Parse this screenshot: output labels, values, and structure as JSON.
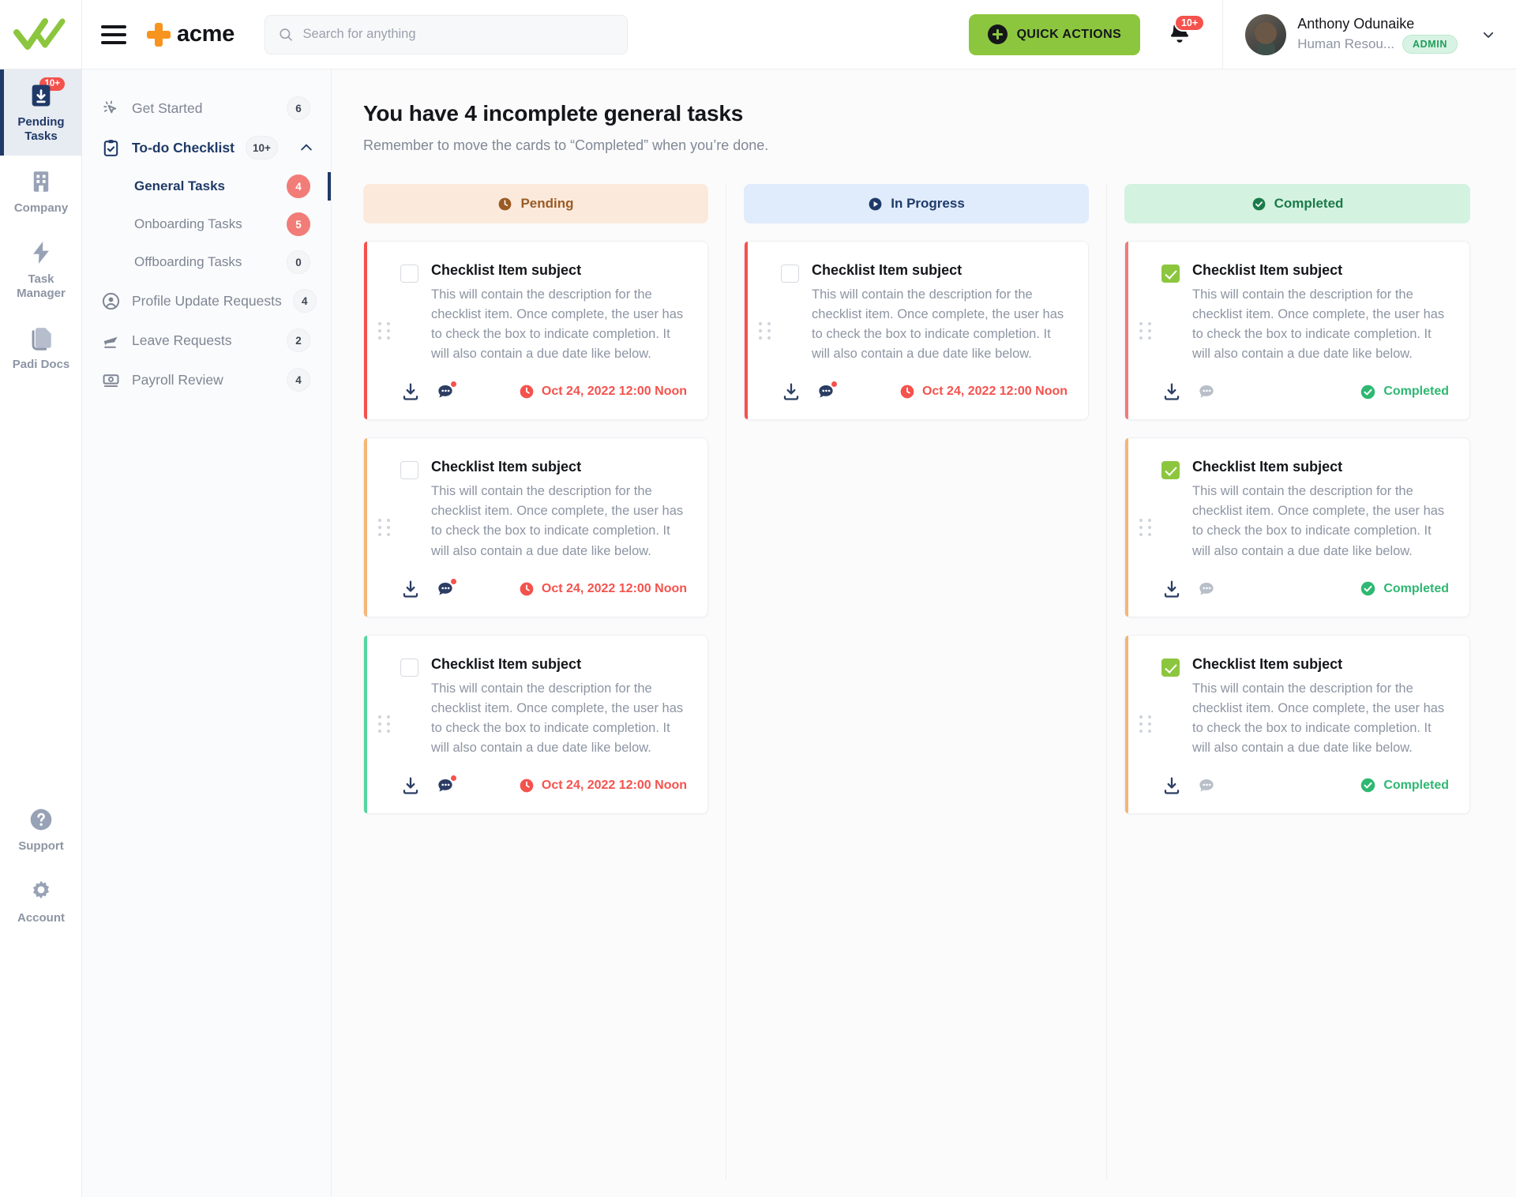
{
  "topbar": {
    "logo_icon": "double-check-logo",
    "menu_icon": "hamburger-menu-icon",
    "brand_icon": "orange-cross-icon",
    "brand_name": "acme",
    "search": {
      "icon": "search-icon",
      "value": "",
      "placeholder": "Search for anything"
    },
    "quick_actions": {
      "icon": "plus-circle-icon",
      "label": "QUICK ACTIONS",
      "color": "#8CC63E"
    },
    "notifications": {
      "icon": "bell-icon",
      "badge": "10+",
      "badge_color": "#F4524D"
    },
    "user": {
      "avatar": "user-avatar",
      "name": "Anthony Odunaike",
      "role": "Human Resou...",
      "tag": "ADMIN",
      "tag_color": "#1f9d5b",
      "chevron": "chevron-down-icon"
    }
  },
  "rail": {
    "items": [
      {
        "icon": "inbox-download-icon",
        "label": "Pending\nTasks",
        "label_line1": "Pending",
        "label_line2": "Tasks",
        "badge": "10+",
        "active": true
      },
      {
        "icon": "building-icon",
        "label": "Company",
        "badge": "",
        "active": false
      },
      {
        "icon": "bolt-icon",
        "label_line1": "Task",
        "label_line2": "Manager",
        "badge": "",
        "active": false
      },
      {
        "icon": "documents-icon",
        "label": "Padi Docs",
        "badge": "",
        "active": false
      }
    ],
    "bottom": [
      {
        "icon": "question-circle-icon",
        "label": "Support"
      },
      {
        "icon": "gear-icon",
        "label": "Account"
      }
    ]
  },
  "subnav": {
    "items": [
      {
        "icon": "cursor-click-icon",
        "label": "Get Started",
        "badge": "6",
        "badge_style": "plain",
        "current": false
      },
      {
        "icon": "clipboard-check-icon",
        "label": "To-do Checklist",
        "badge": "10+",
        "badge_style": "plain",
        "current": true,
        "caret": "chevron-up-icon"
      },
      {
        "icon": "",
        "label": "General Tasks",
        "badge": "4",
        "badge_style": "red",
        "sub": true,
        "selected": true
      },
      {
        "icon": "",
        "label": "Onboarding Tasks",
        "badge": "5",
        "badge_style": "red",
        "sub": true,
        "selected": false
      },
      {
        "icon": "",
        "label": "Offboarding Tasks",
        "badge": "0",
        "badge_style": "plain",
        "sub": true,
        "selected": false
      },
      {
        "icon": "user-circle-icon",
        "label": "Profile Update Requests",
        "badge": "4",
        "badge_style": "plain",
        "current": false
      },
      {
        "icon": "airplane-icon",
        "label": "Leave Requests",
        "badge": "2",
        "badge_style": "plain",
        "current": false
      },
      {
        "icon": "money-icon",
        "label": "Payroll Review",
        "badge": "4",
        "badge_style": "plain",
        "current": false
      }
    ]
  },
  "main": {
    "title": "You have 4 incomplete general tasks",
    "subtitle": "Remember to move the cards to “Completed” when you’re done.",
    "columns": [
      {
        "id": "pending",
        "label": "Pending",
        "icon": "clock-icon",
        "cards": [
          {
            "accent": "#F4524D",
            "checked": false,
            "title": "Checklist Item subject",
            "desc": "This will contain the description for the checklist item. Once complete, the user has to check the box to indicate completion. It will also contain a due date like below.",
            "download_icon": "download-icon",
            "comment_icon": "comment-icon",
            "comment_unread": true,
            "status_icon": "clock-icon",
            "status_text": "Oct 24, 2022 12:00 Noon",
            "status_kind": "due"
          },
          {
            "accent": "#F5B678",
            "checked": false,
            "title": "Checklist Item subject",
            "desc": "This will contain the description for the checklist item. Once complete, the user has to check the box to indicate completion. It will also contain a due date like below.",
            "download_icon": "download-icon",
            "comment_icon": "comment-icon",
            "comment_unread": true,
            "status_icon": "clock-icon",
            "status_text": "Oct 24, 2022 12:00 Noon",
            "status_kind": "due"
          },
          {
            "accent": "#54D6A0",
            "checked": false,
            "title": "Checklist Item subject",
            "desc": "This will contain the description for the checklist item. Once complete, the user has to check the box to indicate completion. It will also contain a due date like below.",
            "download_icon": "download-icon",
            "comment_icon": "comment-icon",
            "comment_unread": true,
            "status_icon": "clock-icon",
            "status_text": "Oct 24, 2022 12:00 Noon",
            "status_kind": "due"
          }
        ]
      },
      {
        "id": "in-progress",
        "label": "In Progress",
        "icon": "play-circle-icon",
        "cards": [
          {
            "accent": "#F4524D",
            "checked": false,
            "title": "Checklist Item subject",
            "desc": "This will contain the description for the checklist item. Once complete, the user has to check the box to indicate completion. It will also contain a due date like below.",
            "download_icon": "download-icon",
            "comment_icon": "comment-icon",
            "comment_unread": true,
            "status_icon": "clock-icon",
            "status_text": "Oct 24, 2022 12:00 Noon",
            "status_kind": "due"
          }
        ]
      },
      {
        "id": "completed",
        "label": "Completed",
        "icon": "check-circle-icon",
        "cards": [
          {
            "accent": "#F27C78",
            "checked": true,
            "title": "Checklist Item subject",
            "desc": "This will contain the description for the checklist item. Once complete, the user has to check the box to indicate completion. It will also contain a due date like below.",
            "download_icon": "download-icon",
            "comment_icon": "comment-icon",
            "comment_unread": false,
            "status_icon": "check-circle-icon",
            "status_text": "Completed",
            "status_kind": "done"
          },
          {
            "accent": "#F5B678",
            "checked": true,
            "title": "Checklist Item subject",
            "desc": "This will contain the description for the checklist item. Once complete, the user has to check the box to indicate completion. It will also contain a due date like below.",
            "download_icon": "download-icon",
            "comment_icon": "comment-icon",
            "comment_unread": false,
            "status_icon": "check-circle-icon",
            "status_text": "Completed",
            "status_kind": "done"
          },
          {
            "accent": "#F5B678",
            "checked": true,
            "title": "Checklist Item subject",
            "desc": "This will contain the description for the checklist item. Once complete, the user has to check the box to indicate completion. It will also contain a due date like below.",
            "download_icon": "download-icon",
            "comment_icon": "comment-icon",
            "comment_unread": false,
            "status_icon": "check-circle-icon",
            "status_text": "Completed",
            "status_kind": "done"
          }
        ]
      }
    ]
  }
}
